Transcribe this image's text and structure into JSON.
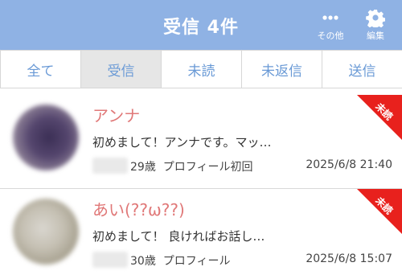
{
  "header": {
    "title": "受信 4件",
    "more_label": "その他",
    "edit_label": "編集"
  },
  "tabs": [
    {
      "label": "全て",
      "active": false
    },
    {
      "label": "受信",
      "active": true
    },
    {
      "label": "未読",
      "active": false
    },
    {
      "label": "未返信",
      "active": false
    },
    {
      "label": "送信",
      "active": false
    }
  ],
  "messages": [
    {
      "name": "アンナ",
      "preview": "初めまして！アンナです。マッ…",
      "age": "29歳",
      "tag": "プロフィール初回",
      "date": "2025/6/8 21:40",
      "badge": "未読"
    },
    {
      "name": "あい(??ω??)",
      "preview": "初めまして！ 良ければお話し…",
      "age": "30歳",
      "tag": "プロフィール",
      "date": "2025/6/8 15:07",
      "badge": "未読"
    }
  ],
  "colors": {
    "header_bg": "#8fb2e4",
    "tab_text": "#6a9ad6",
    "name_text": "#e07878",
    "badge_bg": "#e8211d"
  }
}
